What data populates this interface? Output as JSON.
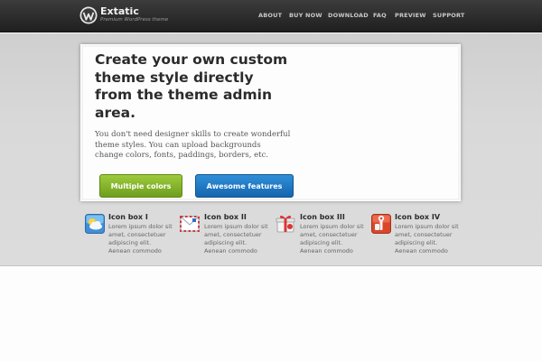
{
  "header": {
    "brand_name": "Extatic",
    "brand_tagline": "Premium WordPress theme",
    "nav": [
      "ABOUT",
      "BUY NOW",
      "DOWNLOAD",
      "FAQ",
      "PREVIEW",
      "SUPPORT"
    ]
  },
  "hero": {
    "title_lines": [
      "Create your own custom",
      "theme style directly",
      "from the theme admin",
      "area."
    ],
    "text_lines": [
      "You don't need designer skills to create wonderful",
      "theme styles. You can upload backgrounds",
      "change colors, fonts, paddings, borders, etc."
    ],
    "buttons": [
      "Multiple colors",
      "Awesome features"
    ]
  },
  "icon_boxes": [
    {
      "title": "Icon box I",
      "icon": "weather-icon",
      "lines": [
        "Lorem ipsum dolor sit",
        "amet, consectetuer",
        "adipiscing elit.",
        "Aenean commodo"
      ]
    },
    {
      "title": "Icon box II",
      "icon": "mail-envelope-icon",
      "lines": [
        "Lorem ipsum dolor sit",
        "amet, consectetuer",
        "adipiscing elit.",
        "Aenean commodo"
      ]
    },
    {
      "title": "Icon box III",
      "icon": "gift-icon",
      "lines": [
        "Lorem ipsum dolor sit",
        "amet, consectetuer",
        "adipiscing elit.",
        "Aenean commodo"
      ]
    },
    {
      "title": "Icon box IV",
      "icon": "tools-icon",
      "lines": [
        "Lorem ipsum dolor sit",
        "amet, consectetuer",
        "adipiscing elit.",
        "Aenean commodo"
      ]
    }
  ],
  "colors": {
    "header_bg": "#2b2b2b",
    "green_button": "#7fb22a",
    "blue_button": "#1d74c4"
  }
}
